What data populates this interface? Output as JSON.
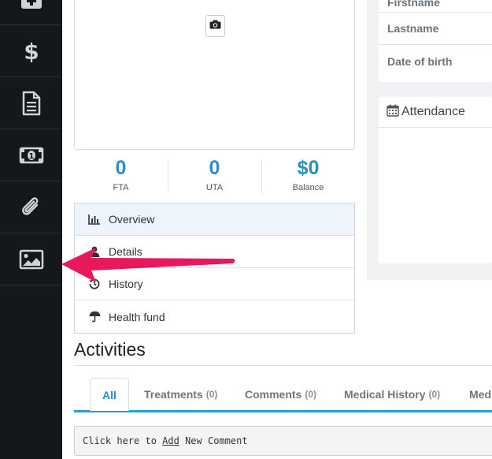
{
  "sidebar": {
    "items": [
      {
        "icon": "medical-kit-icon"
      },
      {
        "icon": "dollar-icon"
      },
      {
        "icon": "document-icon"
      },
      {
        "icon": "money-icon"
      },
      {
        "icon": "paperclip-icon"
      },
      {
        "icon": "image-icon"
      }
    ]
  },
  "profile": {
    "camera_icon": "camera-icon"
  },
  "stats": [
    {
      "value": "0",
      "label": "FTA"
    },
    {
      "value": "0",
      "label": "UTA"
    },
    {
      "value": "$0",
      "label": "Balance"
    }
  ],
  "menu": [
    {
      "label": "Overview",
      "icon": "bar-chart-icon",
      "active": true
    },
    {
      "label": "Details",
      "icon": "user-icon"
    },
    {
      "label": "History",
      "icon": "history-icon"
    },
    {
      "label": "Health fund",
      "icon": "umbrella-icon"
    }
  ],
  "patient_fields": {
    "firstname": "Firstname",
    "lastname": "Lastname",
    "dob": "Date of birth"
  },
  "attendance": {
    "title": "Attendance"
  },
  "activities": {
    "title": "Activities",
    "tabs": [
      {
        "label": "All",
        "count": ""
      },
      {
        "label": "Treatments",
        "count": "(0)"
      },
      {
        "label": "Comments",
        "count": "(0)"
      },
      {
        "label": "Medical History",
        "count": "(0)"
      },
      {
        "label": "Med",
        "count": ""
      }
    ],
    "comment": {
      "prefix": "Click here to ",
      "link": "Add",
      "suffix": " New Comment"
    }
  },
  "colors": {
    "sidebar_bg": "#14181d",
    "accent": "#2a8fc8",
    "tab_underline": "#22a1cf",
    "arrow": "#e8195a"
  }
}
